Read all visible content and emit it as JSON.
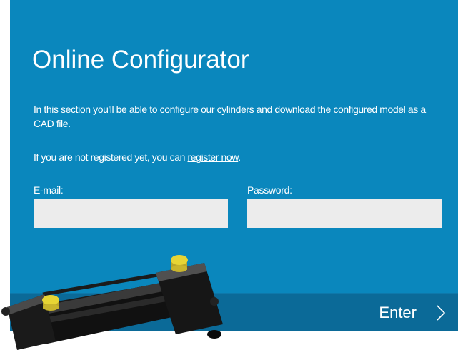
{
  "configurator": {
    "title": "Online Configurator",
    "description": "In this section you'll be able to configure our cylinders and download the configured model as a CAD file.",
    "register_prefix": "If you are not registered yet, you can ",
    "register_link": "register now",
    "register_suffix": ".",
    "email_label": "E-mail:",
    "email_value": "",
    "password_label": "Password:",
    "password_value": "",
    "enter_label": "Enter"
  },
  "icons": {
    "enter": "chevron-right-icon",
    "product": "hydraulic-cylinder-image"
  },
  "colors": {
    "panel_background": "#0a87bd",
    "footer_background": "#0b6a98",
    "field_background": "#ececec",
    "text": "#ffffff",
    "cap_yellow": "#e7d534"
  }
}
